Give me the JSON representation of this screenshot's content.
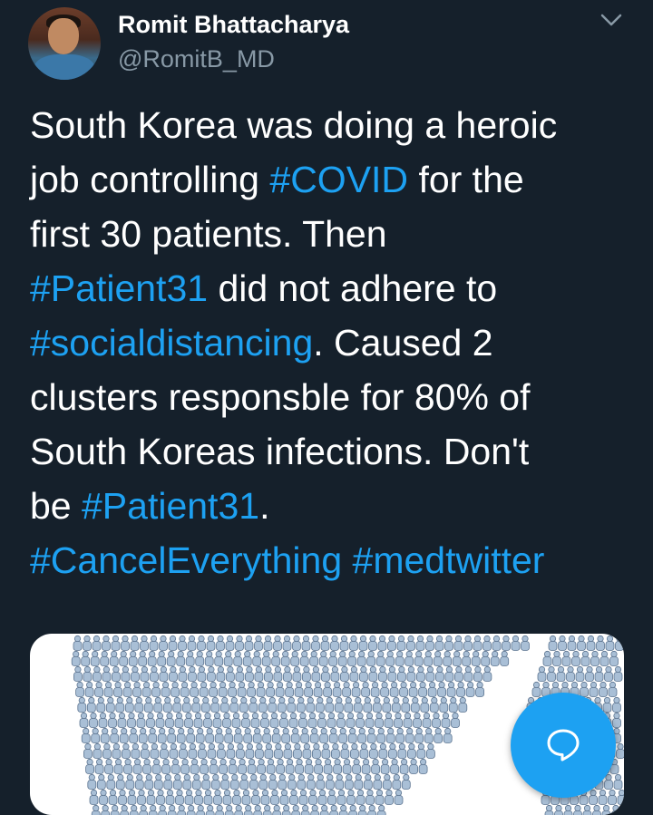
{
  "tweet": {
    "author": {
      "display_name": "Romit Bhattacharya",
      "handle": "@RomitB_MD"
    },
    "lines": [
      [
        {
          "text": "South Korea was doing a heroic",
          "type": "text"
        }
      ],
      [
        {
          "text": "job controlling ",
          "type": "text"
        },
        {
          "text": "#COVID",
          "type": "hashtag"
        },
        {
          "text": " for the",
          "type": "text"
        }
      ],
      [
        {
          "text": "first 30 patients. Then",
          "type": "text"
        }
      ],
      [
        {
          "text": "#Patient31",
          "type": "hashtag"
        },
        {
          "text": " did not adhere to",
          "type": "text"
        }
      ],
      [
        {
          "text": "#socialdistancing",
          "type": "hashtag"
        },
        {
          "text": ". Caused 2",
          "type": "text"
        }
      ],
      [
        {
          "text": "clusters responsble for 80% of",
          "type": "text"
        }
      ],
      [
        {
          "text": "South Koreas infections. Don't",
          "type": "text"
        }
      ],
      [
        {
          "text": "be ",
          "type": "text"
        },
        {
          "text": "#Patient31",
          "type": "hashtag"
        },
        {
          "text": ".",
          "type": "text"
        }
      ],
      [
        {
          "text": "#CancelEverything",
          "type": "hashtag"
        },
        {
          "text": " ",
          "type": "text"
        },
        {
          "text": "#medtwitter",
          "type": "hashtag"
        }
      ]
    ],
    "media": {
      "icon": "people-cluster-illustration"
    }
  },
  "icons": {
    "menu": "chevron-down-icon",
    "compose": "speech-bubble-icon"
  },
  "colors": {
    "background": "#15202b",
    "text": "#ffffff",
    "secondary_text": "#8899a6",
    "hashtag": "#1da1f2",
    "fab": "#1da1f2",
    "figure_fill": "#a9bfd6",
    "figure_stroke": "#5d7591"
  }
}
